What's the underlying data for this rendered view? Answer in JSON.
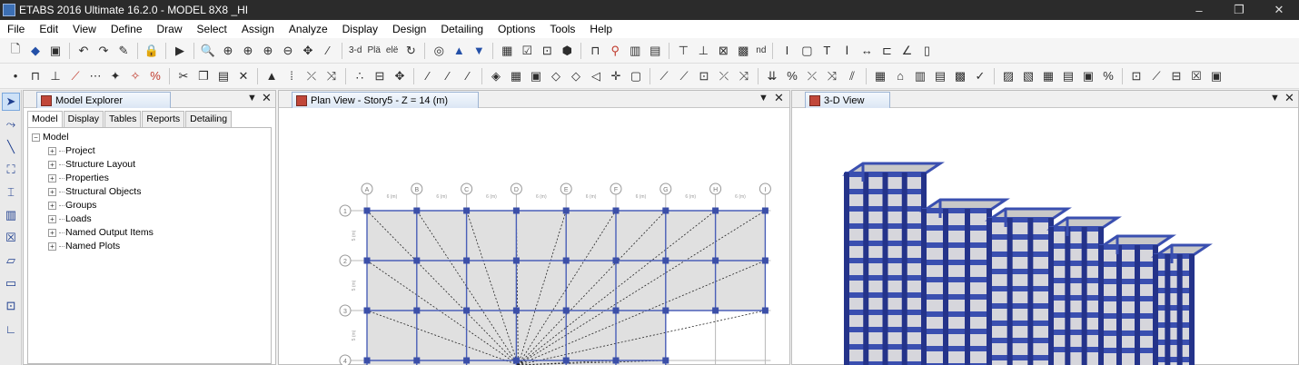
{
  "window": {
    "title": "ETABS 2016 Ultimate 16.2.0 - MODEL 8X8 _HI",
    "controls": [
      "–",
      "❐",
      "✕"
    ]
  },
  "menu": [
    "File",
    "Edit",
    "View",
    "Define",
    "Draw",
    "Select",
    "Assign",
    "Analyze",
    "Display",
    "Design",
    "Detailing",
    "Options",
    "Tools",
    "Help"
  ],
  "toolbar1": {
    "text_3d": "3-d",
    "text_plan": "Plä",
    "text_elev": "elë",
    "text_nd": "nd"
  },
  "explorer": {
    "tab_title": "Model Explorer",
    "subtabs": [
      "Model",
      "Display",
      "Tables",
      "Reports",
      "Detailing"
    ],
    "root": "Model",
    "items": [
      "Project",
      "Structure Layout",
      "Properties",
      "Structural Objects",
      "Groups",
      "Loads",
      "Named Output Items",
      "Named Plots"
    ]
  },
  "plan_view": {
    "tab_title": "Plan View - Story5 - Z = 14 (m)",
    "grid_x_labels": [
      "A",
      "B",
      "C",
      "D",
      "E",
      "F",
      "G",
      "H",
      "I"
    ],
    "grid_y_labels": [
      "1",
      "2",
      "3",
      "4"
    ],
    "spacing_label": "6 (m)",
    "spacing_label_y": "5 (m)"
  },
  "view3d": {
    "tab_title": "3-D View"
  },
  "colors": {
    "frame": "#3a4fb0",
    "frame_dark": "#24338a",
    "slab": "#e0e0e0"
  }
}
